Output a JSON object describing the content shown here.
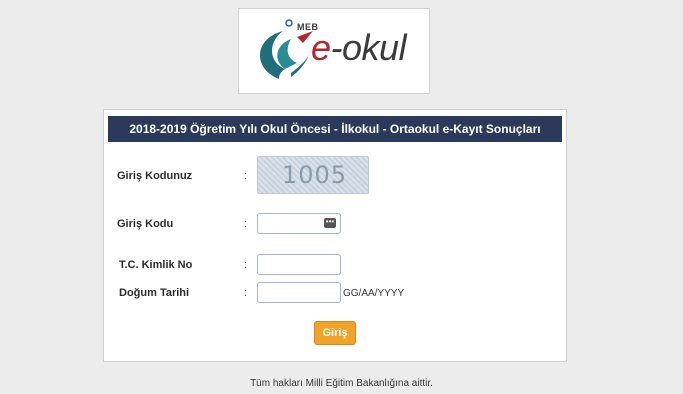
{
  "logo": {
    "meb_text": "MEB",
    "brand_prefix": "e",
    "brand_rest": "-okul",
    "colors": {
      "teal": "#1f6e7a",
      "red": "#b5232b"
    }
  },
  "panel": {
    "title": "2018-2019  Öğretim Yılı Okul Öncesi - İlkokul - Ortaokul e-Kayıt Sonuçları",
    "header_color": "#2b3a5a"
  },
  "form": {
    "captcha_label": "Giriş Kodunuz",
    "captcha_value": "1005",
    "code_label": "Giriş Kodu",
    "tc_label": "T.C. Kimlik No",
    "birth_label": "Doğum Tarihi",
    "colon": ":",
    "birth_hint": "GG/AA/YYYY",
    "submit_label": "Giriş",
    "submit_color": "#f0a229"
  },
  "footer": {
    "text": "Tüm hakları Milli Eğitim Bakanlığına aittir."
  }
}
